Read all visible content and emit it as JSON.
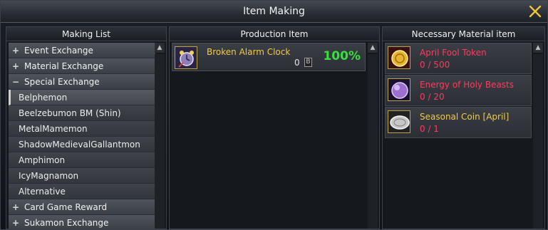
{
  "window": {
    "title": "Item Making"
  },
  "making_list": {
    "header": "Making List",
    "rows": [
      {
        "kind": "cat",
        "symbol": "+",
        "label": "Event Exchange"
      },
      {
        "kind": "cat",
        "symbol": "+",
        "label": "Material Exchange"
      },
      {
        "kind": "cat",
        "symbol": "−",
        "label": "Special Exchange"
      },
      {
        "kind": "sub",
        "label": "Belphemon",
        "selected": true
      },
      {
        "kind": "sub",
        "label": "Beelzebumon BM (Shin)"
      },
      {
        "kind": "sub",
        "label": "MetalMamemon"
      },
      {
        "kind": "sub",
        "label": "ShadowMedievalGallantmon"
      },
      {
        "kind": "sub",
        "label": "Amphimon"
      },
      {
        "kind": "sub",
        "label": "IcyMagnamon"
      },
      {
        "kind": "sub",
        "label": "Alternative"
      },
      {
        "kind": "cat",
        "symbol": "+",
        "label": "Card Game Reward"
      },
      {
        "kind": "cat",
        "symbol": "+",
        "label": "Sukamon Exchange"
      }
    ]
  },
  "production": {
    "header": "Production Item",
    "item": {
      "name": "Broken Alarm Clock",
      "count": "0",
      "badge": "B",
      "percent": "100%",
      "icon": "alarm-clock-icon"
    }
  },
  "materials": {
    "header": "Necessary Material item",
    "items": [
      {
        "name": "April Fool Token",
        "qty": "0 / 500",
        "name_color": "#ff3a5c",
        "icon": "gold-token-icon"
      },
      {
        "name": "Energy of Holy Beasts",
        "qty": "0 / 20",
        "name_color": "#ff3a5c",
        "icon": "purple-orb-icon"
      },
      {
        "name": "Seasonal Coin [April]",
        "qty": "0 / 1",
        "name_color": "#f2c94a",
        "icon": "silver-coin-icon"
      }
    ]
  }
}
